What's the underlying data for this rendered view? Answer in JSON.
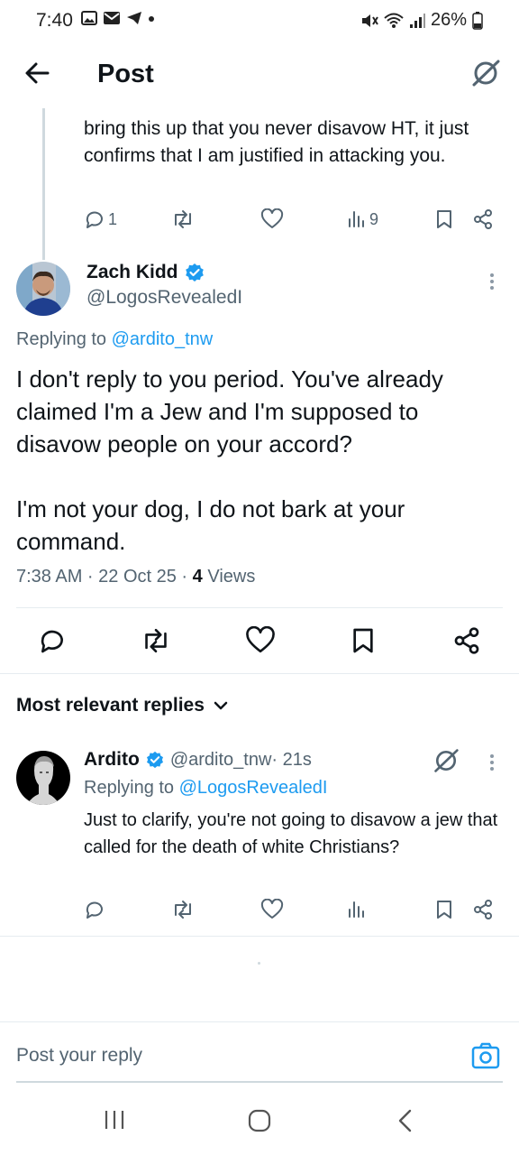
{
  "status_bar": {
    "time": "7:40",
    "battery": "26%"
  },
  "header": {
    "title": "Post"
  },
  "parent_post": {
    "text": "bring this up that you never disavow HT, it just confirms that I am justified in attacking you.",
    "reply_count": "1",
    "view_count": "9"
  },
  "main_post": {
    "author_name": "Zach Kidd",
    "author_handle": "@LogosRevealedI",
    "replying_prefix": "Replying to ",
    "replying_to": "@ardito_tnw",
    "text_p1": "I don't reply to you period. You've already claimed I'm a Jew and I'm supposed to disavow people on your accord?",
    "text_p2": "I'm not your dog, I do not bark at your command.",
    "timestamp": "7:38 AM · 22 Oct 25 · ",
    "views_count": "4",
    "views_label": " Views"
  },
  "replies_header": {
    "label": "Most relevant replies"
  },
  "reply": {
    "author_name": "Ardito",
    "author_handle": "@ardito_tnw",
    "time": " · 21s",
    "replying_prefix": "Replying to ",
    "replying_to": "@LogosRevealedI",
    "text": "Just to clarify, you're not going to disavow a jew that called for the death of white Christians?"
  },
  "composer": {
    "placeholder": "Post your reply"
  },
  "colors": {
    "accent": "#1d9bf0",
    "verified": "#1d9bf0",
    "secondary_text": "#536471"
  },
  "icons": [
    "back-arrow-icon",
    "grok-icon",
    "reply-icon",
    "repost-icon",
    "like-icon",
    "views-icon",
    "bookmark-icon",
    "share-icon",
    "verified-badge-icon",
    "more-icon",
    "chevron-down-icon",
    "camera-icon"
  ]
}
